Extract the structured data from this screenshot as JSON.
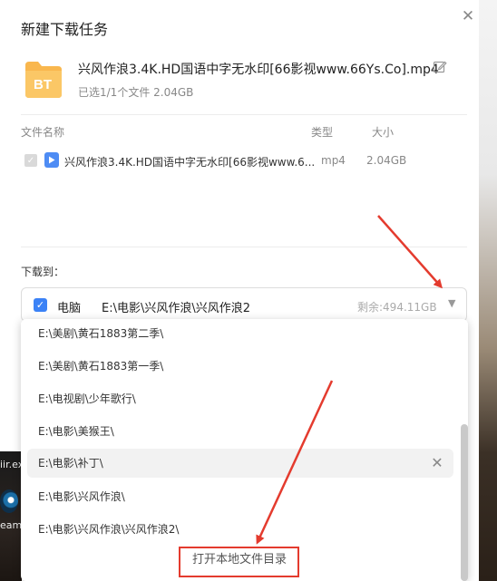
{
  "dialog": {
    "title": "新建下载任务",
    "close_icon": "close-icon"
  },
  "torrent": {
    "icon_label": "BT",
    "title": "兴风作浪3.4K.HD国语中字无水印[66影视www.66Ys.Co].mp4",
    "summary": "已选1/1个文件 2.04GB"
  },
  "file_table": {
    "headers": {
      "name": "文件名称",
      "type": "类型",
      "size": "大小"
    },
    "rows": [
      {
        "name": "兴风作浪3.4K.HD国语中字无水印[66影视www.6...",
        "type": "mp4",
        "size": "2.04GB",
        "checked": true
      }
    ]
  },
  "save_to": {
    "label": "下载到：",
    "target": "电脑",
    "path": "E:\\电影\\兴风作浪\\兴风作浪2",
    "free_space": "剩余:494.11GB"
  },
  "dropdown": {
    "items": [
      "E:\\美剧\\黄石1883第二季\\",
      "E:\\美剧\\黄石1883第一季\\",
      "E:\\电视剧\\少年歌行\\",
      "E:\\电影\\美猴王\\",
      "E:\\电影\\补丁\\",
      "E:\\电影\\兴风作浪\\",
      "E:\\电影\\兴风作浪\\兴风作浪2\\"
    ],
    "selected_index": 4,
    "open_folder_label": "打开本地文件目录"
  },
  "desktop": {
    "exe_label": "iir.ex",
    "steam_label": "eam"
  },
  "colors": {
    "accent": "#3b82f6",
    "annotation": "#e43b2e",
    "bt_orange": "#f9b74e"
  }
}
